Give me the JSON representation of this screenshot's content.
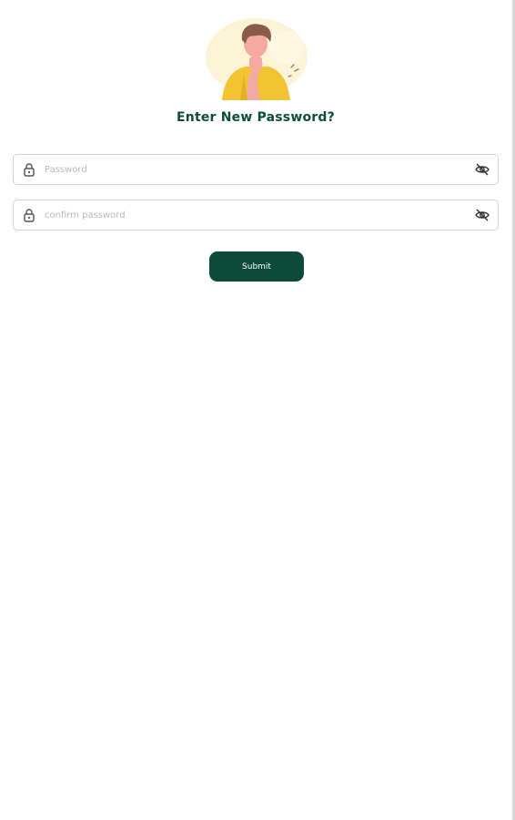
{
  "header": {
    "illustration_icon": "thinking-person-illustration",
    "title": "Enter New Password?"
  },
  "form": {
    "password": {
      "placeholder": "Password",
      "value": "",
      "lock_icon": "lock-icon",
      "toggle_icon": "eye-off-icon"
    },
    "confirm_password": {
      "placeholder": "confirm password",
      "value": "",
      "lock_icon": "lock-icon",
      "toggle_icon": "eye-off-icon"
    },
    "submit_label": "Submit"
  },
  "colors": {
    "primary": "#0e4a3a",
    "title": "#0f4d3a",
    "border": "#d3d3d3",
    "placeholder": "#b9b9b9",
    "illustration_shirt": "#f2c433",
    "illustration_hair": "#8a5a4a",
    "illustration_skin": "#f5a9a3"
  }
}
